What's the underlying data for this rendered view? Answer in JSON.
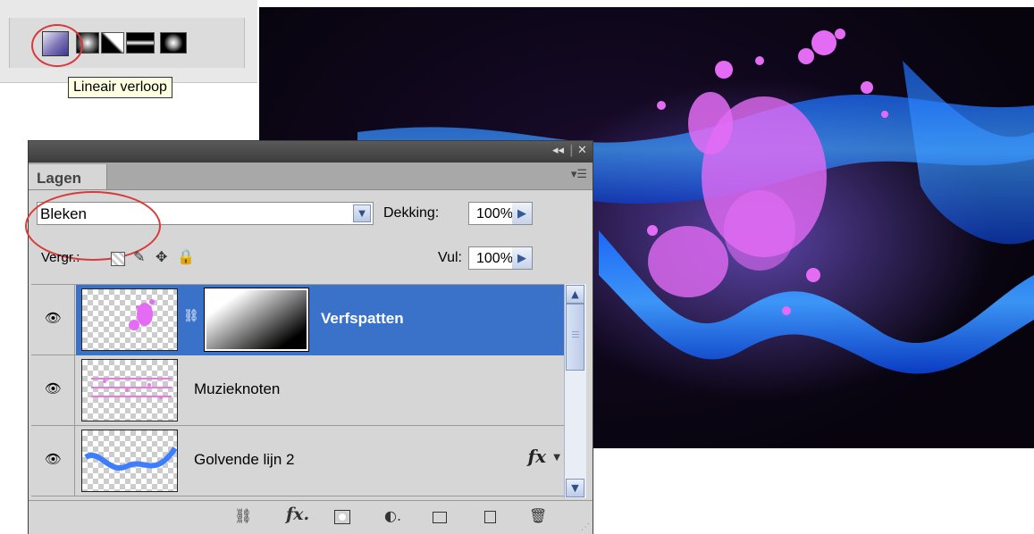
{
  "gradient_toolbar": {
    "buttons": [
      {
        "name": "linear-gradient-button"
      },
      {
        "name": "radial-gradient-button"
      },
      {
        "name": "angle-gradient-button"
      },
      {
        "name": "reflected-gradient-button"
      },
      {
        "name": "diamond-gradient-button"
      }
    ],
    "tooltip": "Lineair verloop"
  },
  "layers_panel": {
    "titlebar": {
      "collapse_icon": "double-chevron-left-icon",
      "close_icon": "close-icon"
    },
    "tab_label": "Lagen",
    "blend_mode": "Bleken",
    "opacity_label": "Dekking:",
    "opacity_value": "100%",
    "lock_label": "Vergr.:",
    "fill_label": "Vul:",
    "fill_value": "100%",
    "layers": [
      {
        "name": "Verfspatten",
        "selected": true,
        "has_mask": true,
        "has_fx": false
      },
      {
        "name": "Muzieknoten",
        "selected": false,
        "has_mask": false,
        "has_fx": false
      },
      {
        "name": "Golvende lijn 2",
        "selected": false,
        "has_mask": false,
        "has_fx": true,
        "fx_label": "fx"
      }
    ],
    "bottom_icons": [
      "link-layers-icon",
      "fx-icon",
      "add-mask-icon",
      "adjustment-layer-icon",
      "new-group-icon",
      "new-layer-icon",
      "trash-icon"
    ]
  }
}
